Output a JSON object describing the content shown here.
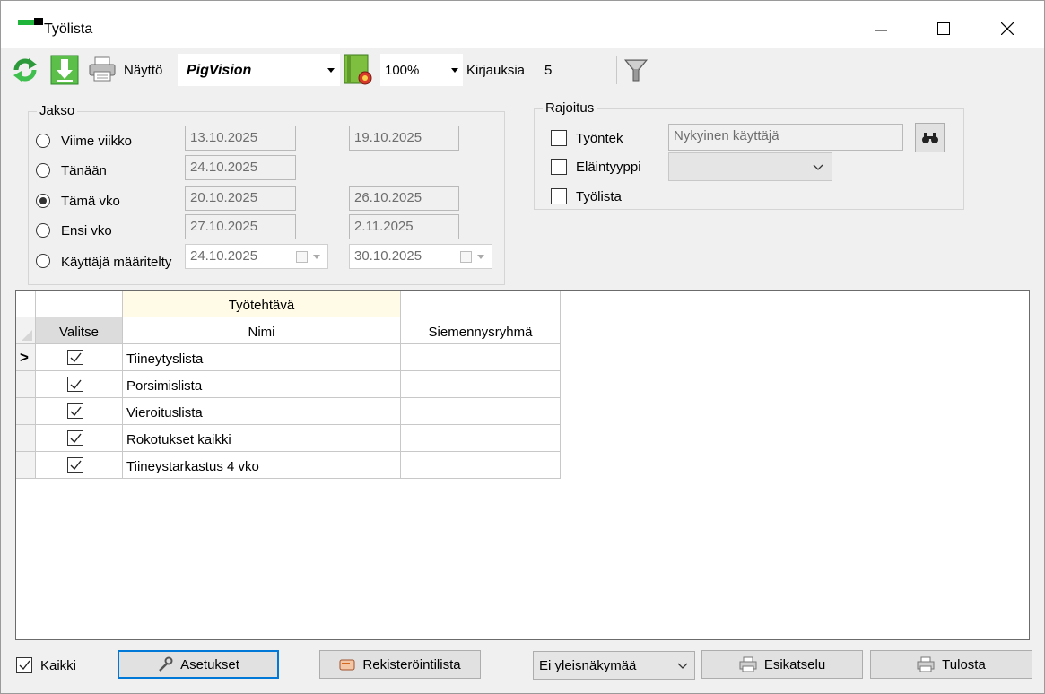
{
  "window": {
    "title": "Työlista"
  },
  "toolbar": {
    "view_label": "Näyttö",
    "view_value": "PigVision",
    "zoom_value": "100%",
    "records_label": "Kirjauksia",
    "records_value": "5"
  },
  "period": {
    "title": "Jakso",
    "options": [
      {
        "label": "Viime viikko",
        "from": "13.10.2025",
        "to": "19.10.2025",
        "selected": false
      },
      {
        "label": "Tänään",
        "from": "24.10.2025",
        "to": "",
        "selected": false
      },
      {
        "label": "Tämä vko",
        "from": "20.10.2025",
        "to": "26.10.2025",
        "selected": true
      },
      {
        "label": "Ensi vko",
        "from": "27.10.2025",
        "to": "2.11.2025",
        "selected": false
      },
      {
        "label": "Käyttäjä määritelty",
        "from": "24.10.2025",
        "to": "30.10.2025",
        "selected": false
      }
    ]
  },
  "restriction": {
    "title": "Rajoitus",
    "employee_label": "Työntek",
    "employee_value": "Nykyinen käyttäjä",
    "animal_type_label": "Eläintyyppi",
    "worklist_label": "Työlista"
  },
  "grid": {
    "group_header": "Työtehtävä",
    "col_select": "Valitse",
    "col_name": "Nimi",
    "col_group": "Siemennysryhmä",
    "current_row_marker": ">",
    "rows": [
      {
        "name": "Tiineytyslista",
        "group": "",
        "checked": true
      },
      {
        "name": "Porsimislista",
        "group": "",
        "checked": true
      },
      {
        "name": "Vieroituslista",
        "group": "",
        "checked": true
      },
      {
        "name": "Rokotukset kaikki",
        "group": "",
        "checked": true
      },
      {
        "name": "Tiineystarkastus 4 vko",
        "group": "",
        "checked": true
      }
    ]
  },
  "footer": {
    "all_label": "Kaikki",
    "settings_label": "Asetukset",
    "register_label": "Rekisteröintilista",
    "general_view_value": "Ei yleisnäkymää",
    "preview_label": "Esikatselu",
    "print_label": "Tulosta"
  },
  "colors": {
    "accent": "#0078d7",
    "group_header_bg": "#fffbe6",
    "logo_green": "#1fb43a"
  }
}
